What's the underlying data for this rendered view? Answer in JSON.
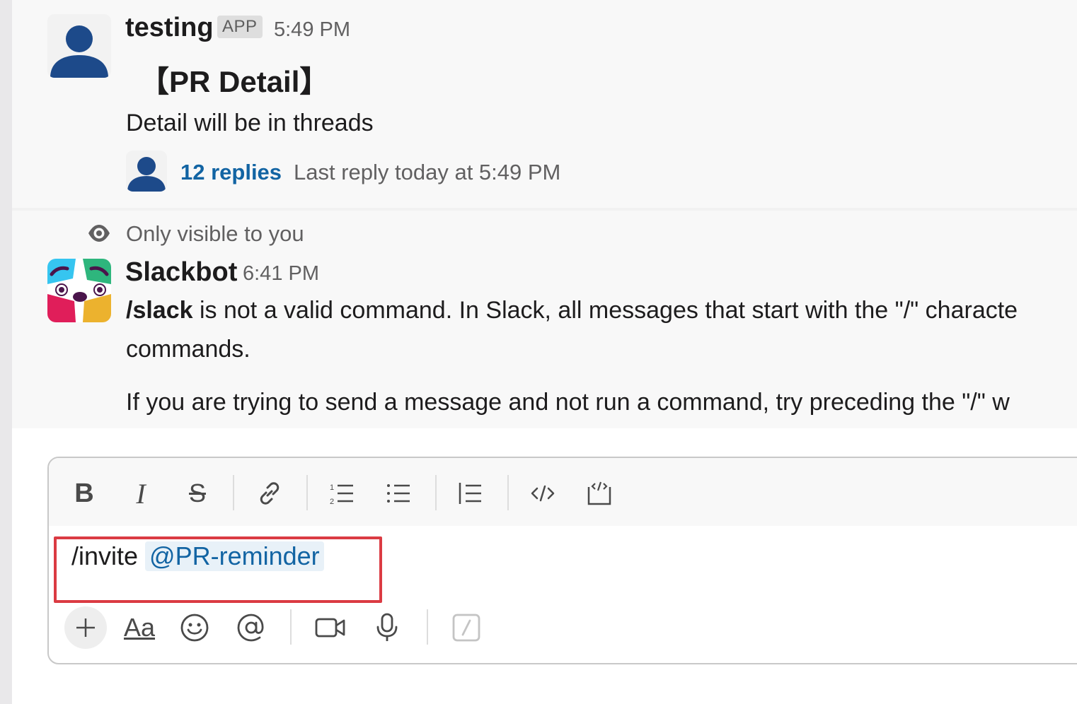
{
  "messages": [
    {
      "author": "testing",
      "badge": "APP",
      "time": "5:49 PM",
      "heading": "【PR Detail】",
      "text": "Detail will be in threads",
      "thread": {
        "replies": "12 replies",
        "last_reply": "Last reply today at 5:49 PM"
      }
    },
    {
      "visibility": "Only visible to you",
      "author": "Slackbot",
      "time": "6:41 PM",
      "line1_command": "/slack",
      "line1_rest": " is not a valid command. In Slack, all messages that start with the \"/\" characte",
      "line2": "commands.",
      "line3": "If you are trying to send a message and not run a command, try preceding the \"/\" w"
    }
  ],
  "composer": {
    "input_command": "/invite",
    "input_mention": "@PR-reminder",
    "toolbar_icons": [
      "bold-icon",
      "italic-icon",
      "strikethrough-icon",
      "link-icon",
      "ordered-list-icon",
      "bulleted-list-icon",
      "blockquote-icon",
      "code-icon",
      "code-block-icon"
    ],
    "bottom_icons": [
      "plus-icon",
      "formatting-icon",
      "emoji-icon",
      "mention-icon",
      "video-icon",
      "microphone-icon",
      "shortcuts-icon"
    ]
  },
  "colors": {
    "link": "#1264a3",
    "highlight_border": "#db3b43",
    "avatar_blue": "#1d4a8a"
  }
}
